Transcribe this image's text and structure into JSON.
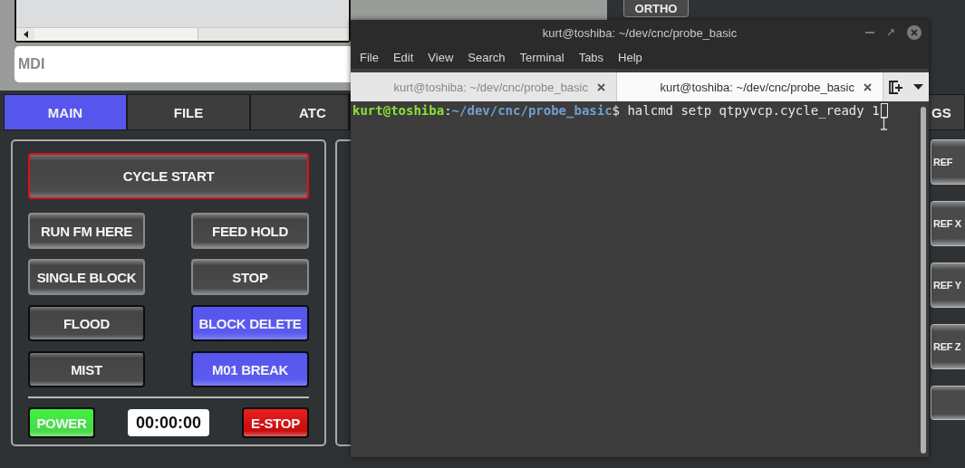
{
  "mdi": {
    "placeholder": "MDI"
  },
  "ortho_button": "ORTHO",
  "tabs": [
    {
      "label": "MAIN",
      "selected": true
    },
    {
      "label": "FILE",
      "selected": false
    },
    {
      "label": "ATC",
      "selected": false
    },
    {
      "label": "GS",
      "selected": false
    }
  ],
  "main_panel": {
    "cycle_start": "CYCLE START",
    "buttons": [
      {
        "label": "RUN FM HERE",
        "kind": "action"
      },
      {
        "label": "FEED HOLD",
        "kind": "action"
      },
      {
        "label": "SINGLE BLOCK",
        "kind": "action"
      },
      {
        "label": "STOP",
        "kind": "action"
      },
      {
        "label": "FLOOD",
        "kind": "toggle",
        "checked": false
      },
      {
        "label": "BLOCK DELETE",
        "kind": "toggle",
        "checked": true
      },
      {
        "label": "MIST",
        "kind": "toggle",
        "checked": false
      },
      {
        "label": "M01 BREAK",
        "kind": "toggle",
        "checked": true
      }
    ],
    "power": "POWER",
    "timer": "00:00:00",
    "estop": "E-STOP"
  },
  "ref_buttons": [
    "REF",
    "REF X",
    "REF Y",
    "REF Z"
  ],
  "terminal": {
    "title": "kurt@toshiba: ~/dev/cnc/probe_basic",
    "menu": [
      "File",
      "Edit",
      "View",
      "Search",
      "Terminal",
      "Tabs",
      "Help"
    ],
    "tabs": [
      {
        "label": "kurt@toshiba: ~/dev/cnc/probe_basic",
        "selected": false
      },
      {
        "label": "kurt@toshiba: ~/dev/cnc/probe_basic",
        "selected": true
      }
    ],
    "line": {
      "user": "kurt@toshiba",
      "sep": ":",
      "path": "~/dev/cnc/probe_basic",
      "prompt": "$",
      "command": "halcmd setp qtpyvcp.cycle_ready 1"
    }
  }
}
